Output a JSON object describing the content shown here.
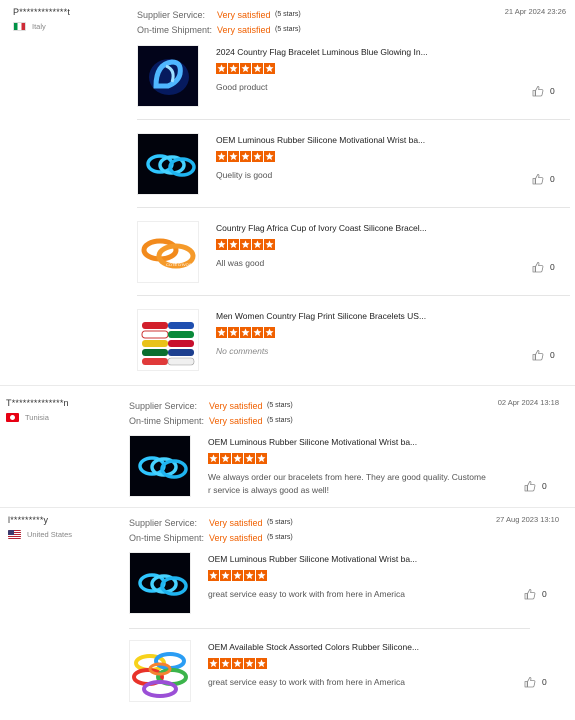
{
  "labels": {
    "supplier_service": "Supplier Service:",
    "ontime_shipment": "On-time Shipment:"
  },
  "colors": {
    "accent": "#f06000",
    "star": "#f06000"
  },
  "reviews": [
    {
      "reviewer": "P*************t",
      "country": "Italy",
      "flag": "italy-flag-icon",
      "supplier_rating": "Very satisfied",
      "supplier_stars": "(5 stars)",
      "shipment_rating": "Very satisfied",
      "shipment_stars": "(5 stars)",
      "date": "21 Apr 2024 23:26",
      "items": [
        {
          "title": "2024 Country Flag Bracelet Luminous Blue Glowing In...",
          "stars": 5,
          "comment": "Good product",
          "helpful": "0",
          "image": "glowing-bracelet-image"
        },
        {
          "title": "OEM Luminous Rubber Silicone Motivational Wrist ba...",
          "stars": 5,
          "comment": "Quelity is good",
          "helpful": "0",
          "image": "luminous-wristband-image"
        },
        {
          "title": "Country Flag Africa Cup of Ivory Coast Silicone Bracel...",
          "stars": 5,
          "comment": "All was good",
          "helpful": "0",
          "image": "orange-bracelet-image"
        },
        {
          "title": "Men Women Country Flag Print Silicone Bracelets US...",
          "stars": 5,
          "comment": "No comments",
          "helpful": "0",
          "image": "flag-bracelets-image"
        }
      ]
    },
    {
      "reviewer": "T**************n",
      "country": "Tunisia",
      "flag": "tunisia-flag-icon",
      "supplier_rating": "Very satisfied",
      "supplier_stars": "(5 stars)",
      "shipment_rating": "Very satisfied",
      "shipment_stars": "(5 stars)",
      "date": "02 Apr 2024 13:18",
      "items": [
        {
          "title": "OEM Luminous Rubber Silicone Motivational Wrist ba...",
          "stars": 5,
          "comment": "We always order our bracelets from here. They are good quality. Custome r service is always good as well!",
          "helpful": "0",
          "image": "luminous-wristband-image"
        }
      ]
    },
    {
      "reviewer": "l*********y",
      "country": "United States",
      "flag": "usa-flag-icon",
      "supplier_rating": "Very satisfied",
      "supplier_stars": "(5 stars)",
      "shipment_rating": "Very satisfied",
      "shipment_stars": "(5 stars)",
      "date": "27 Aug 2023 13:10",
      "items": [
        {
          "title": "OEM Luminous Rubber Silicone Motivational Wrist ba...",
          "stars": 5,
          "comment": "great service easy to work with from here in America",
          "helpful": "0",
          "image": "luminous-wristband-image"
        },
        {
          "title": "OEM Available Stock Assorted Colors Rubber Silicone...",
          "stars": 5,
          "comment": "great service easy to work with from here in America",
          "helpful": "0",
          "image": "assorted-bracelets-image"
        }
      ]
    }
  ]
}
